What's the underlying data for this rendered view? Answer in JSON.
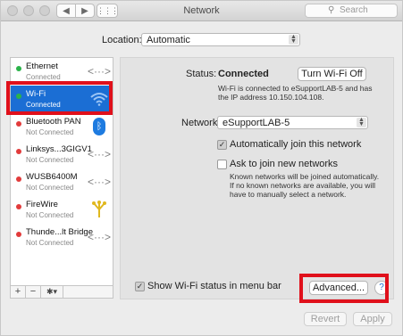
{
  "window": {
    "title": "Network"
  },
  "toolbar": {
    "search_placeholder": "Search"
  },
  "location": {
    "label": "Location:",
    "value": "Automatic"
  },
  "services": [
    {
      "name": "Ethernet",
      "status": "Connected",
      "dot": "#2bb34a",
      "icon": "ethernet-arrows-icon",
      "glyph": "<···>"
    },
    {
      "name": "Wi-Fi",
      "status": "Connected",
      "dot": "#2bb34a",
      "icon": "wifi-icon",
      "glyph": ""
    },
    {
      "name": "Bluetooth PAN",
      "status": "Not Connected",
      "dot": "#e23b3b",
      "icon": "bluetooth-icon",
      "glyph": "ᛒ"
    },
    {
      "name": "Linksys...3GIGV1",
      "status": "Not Connected",
      "dot": "#e23b3b",
      "icon": "ethernet-arrows-icon",
      "glyph": "<···>"
    },
    {
      "name": "WUSB6400M",
      "status": "Not Connected",
      "dot": "#e23b3b",
      "icon": "ethernet-arrows-icon",
      "glyph": "<···>"
    },
    {
      "name": "FireWire",
      "status": "Not Connected",
      "dot": "#e23b3b",
      "icon": "firewire-icon",
      "glyph": "Y"
    },
    {
      "name": "Thunde...lt Bridge",
      "status": "Not Connected",
      "dot": "#e23b3b",
      "icon": "ethernet-arrows-icon",
      "glyph": "<···>"
    }
  ],
  "sidebar_footer": {
    "add": "+",
    "remove": "−",
    "action": "✱▾"
  },
  "status": {
    "label": "Status:",
    "value": "Connected",
    "detail": "Wi-Fi is connected to eSupportLAB-5 and has the IP address 10.150.104.108.",
    "turn_off_button": "Turn Wi-Fi Off"
  },
  "network_name": {
    "label": "Network Name:",
    "value": "eSupportLAB-5"
  },
  "auto_join": {
    "label": "Automatically join this network",
    "checked": true
  },
  "ask_join": {
    "label": "Ask to join new networks",
    "checked": false,
    "description": "Known networks will be joined automatically. If no known networks are available, you will have to manually select a network."
  },
  "show_status": {
    "label": "Show Wi-Fi status in menu bar",
    "checked": true
  },
  "advanced_button": "Advanced...",
  "help_button": "?",
  "revert_button": "Revert",
  "apply_button": "Apply",
  "colors": {
    "highlight": "#e0101b",
    "selection": "#1b6ed4"
  }
}
